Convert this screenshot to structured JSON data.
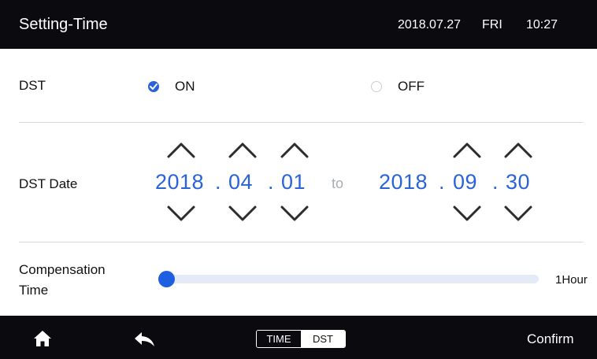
{
  "header": {
    "title": "Setting-Time",
    "date": "2018.07.27",
    "day": "FRI",
    "time": "10:27"
  },
  "dst": {
    "label": "DST",
    "options": [
      {
        "label": "ON",
        "selected": true
      },
      {
        "label": "OFF",
        "selected": false
      }
    ]
  },
  "dst_date": {
    "label": "DST Date",
    "start": {
      "year": "2018",
      "month": "04",
      "day": "01"
    },
    "separator": "to",
    "end": {
      "year": "2018",
      "month": "09",
      "day": "30"
    },
    "dot": "."
  },
  "compensation": {
    "label_line1": "Compensation",
    "label_line2": "Time",
    "value": "1Hour",
    "level": 0
  },
  "footer": {
    "tabs": [
      "TIME",
      "DST"
    ],
    "active_tab": "DST",
    "confirm": "Confirm"
  },
  "colors": {
    "accent": "#2a63d9",
    "bar": "#0b0b0f",
    "track": "#e4ebf7",
    "muted": "#a9adb3"
  },
  "icons": [
    "home-icon",
    "back-icon",
    "chevron-up-icon",
    "chevron-down-icon",
    "check-icon"
  ]
}
